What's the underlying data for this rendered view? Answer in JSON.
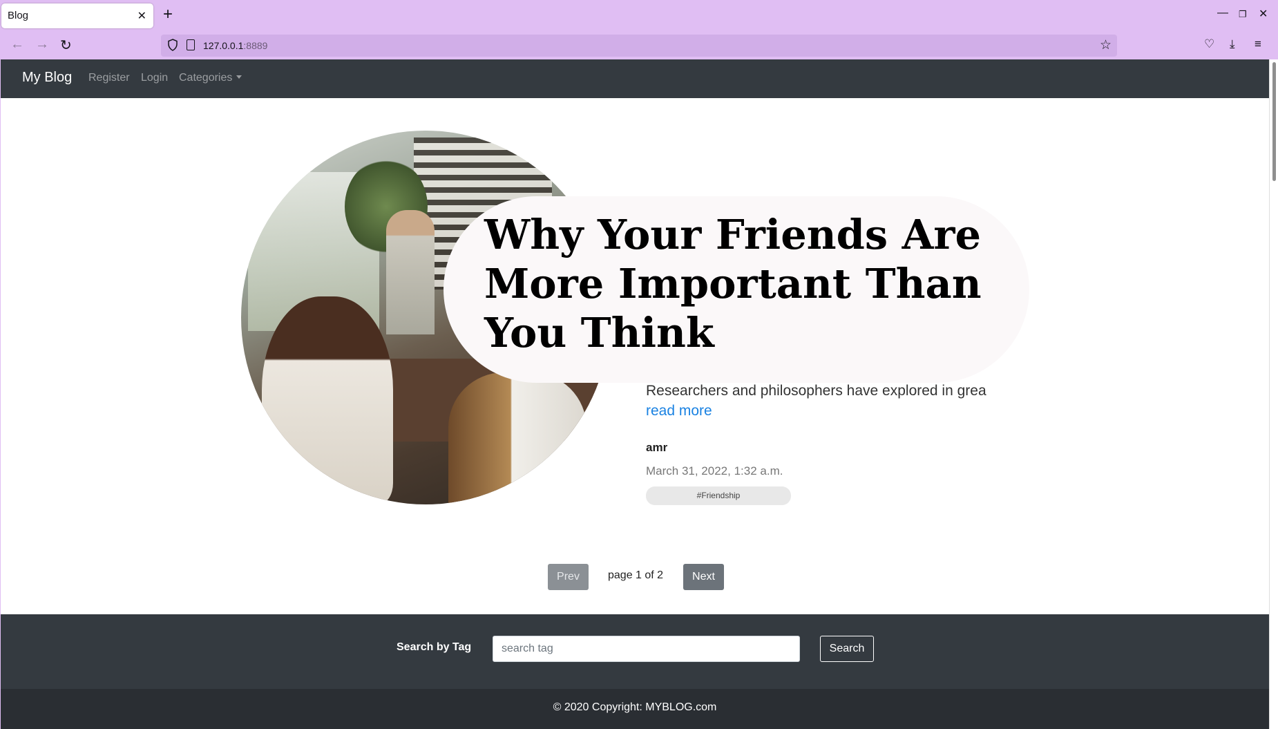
{
  "browser": {
    "tab_title": "Blog",
    "url_host": "127.0.0.1",
    "url_port": ":8889"
  },
  "site": {
    "brand": "My Blog",
    "nav": {
      "register": "Register",
      "login": "Login",
      "categories": "Categories"
    }
  },
  "post": {
    "title": "Why Your Friends Are More Important Than You Think",
    "excerpt": "Researchers and philosophers have explored in grea",
    "read_more": "read more",
    "author": "amr",
    "date": "March 31, 2022, 1:32 a.m.",
    "tag": "#Friendship"
  },
  "pagination": {
    "prev": "Prev",
    "info": "page 1 of 2",
    "next": "Next"
  },
  "search": {
    "label": "Search by Tag",
    "placeholder": "search tag",
    "value": "",
    "button": "Search"
  },
  "footer": {
    "copyright": "© 2020 Copyright: MYBLOG.com"
  },
  "colors": {
    "chrome": "#e0bef3",
    "navbar": "#343a40",
    "link": "#1a82e2",
    "footer": "#2a2e33"
  }
}
